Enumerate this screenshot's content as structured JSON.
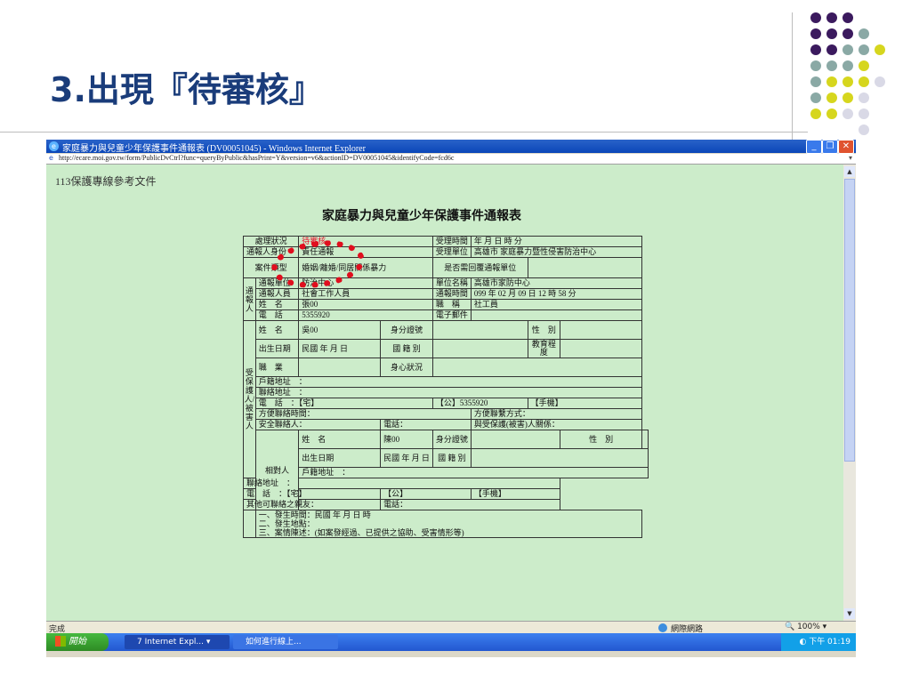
{
  "slide": {
    "title": "3.出現『待審核』",
    "palette": {
      "purple": "#3b1a5e",
      "teal": "#8aa9a5",
      "yellow": "#d6d61e",
      "light": "#d9d9e6"
    }
  },
  "window": {
    "title": "家庭暴力與兒童少年保護事件通報表 (DV00051045) - Windows Internet Explorer",
    "address": "http://ecare.moi.gov.tw/form/PublicDvCtrl?func=queryByPublic&hasPrint=Y&version=v6&actionID=DV00051045&identifyCode=fcd6c",
    "status_text": "完成",
    "zone": "網際網路",
    "zoom": "100%",
    "minimize_icon": "minimize-icon",
    "maximize_icon": "restore-icon",
    "close_icon": "close-icon"
  },
  "taskbar": {
    "start": "開始",
    "items": [
      "7 Internet Expl...",
      "如何進行線上..."
    ],
    "clock": "下午 01:19"
  },
  "document": {
    "ref_text": "113保護專線參考文件",
    "heading": "家庭暴力與兒童少年保護事件通報表"
  },
  "report": {
    "row1": {
      "status_label": "處理狀況",
      "status_value": "待審核",
      "time_label": "受理時間",
      "time_value": "年 月 日 時 分"
    },
    "row2": {
      "identity_label": "通報人身份",
      "identity_value": "責任通報",
      "unit_label": "受理單位",
      "unit_value": "高雄市 家庭暴力暨性侵害防治中心"
    },
    "row3": {
      "type_label": "案件類型",
      "type_value": "婚姻/離婚/同居關係暴力",
      "reply_label": "是否需回覆通報單位"
    },
    "reporter": {
      "group_label": "通報人",
      "unit_label": "通報單位",
      "unit_value": "防治中心",
      "unitname_label": "單位名稱",
      "unitname_value": "高雄市家防中心",
      "person_label": "通報人員",
      "person_value": "社會工作人員",
      "rtime_label": "通報時間",
      "rtime_value": "099 年 02 月 09 日 12 時 58 分",
      "name_label": "姓　名",
      "name_value": "張00",
      "title_label": "職　稱",
      "title_value": "社工員",
      "phone_label": "電　話",
      "phone_value": "5355920",
      "email_label": "電子郵件"
    },
    "victim": {
      "group_label": "受保護人/被害人",
      "name_label": "姓　名",
      "name_value": "吳00",
      "id_label": "身分證號",
      "sex_label": "性　別",
      "birth_label": "出生日期",
      "birth_value": "民國 年 月 日",
      "nationality_label": "國 籍 別",
      "edu_label": "教育程度",
      "job_label": "職　業",
      "health_label": "身心狀況",
      "registered_addr": "戶籍地址　：",
      "contact_addr": "聯絡地址　：",
      "phone_line": [
        "電　話　：【宅】",
        "【公】5355920",
        "【手機】"
      ],
      "contact_time": "方便聯絡時間：",
      "contact_method": "方便聯繫方式：",
      "safe_contact": "安全聯絡人：",
      "safe_phone": "電話：",
      "relation": "與受保護(被害)人關係："
    },
    "offender": {
      "group_label": "相對人",
      "name_label": "姓　名",
      "name_value": "陳00",
      "id_label": "身分證號",
      "sex_label": "性　別",
      "birth_label": "出生日期",
      "birth_value": "民國 年 月 日",
      "nationality_label": "國 籍 別",
      "registered_addr": "戶籍地址　：",
      "contact_addr": "聯絡地址　：",
      "phone_line": [
        "電　話　：【宅】",
        "【公】",
        "【手機】"
      ],
      "other_contact": "其他可聯絡之親友：",
      "other_phone": "電話："
    },
    "incident": [
      "一、發生時間：民國 年 月 日 時",
      "二、發生地點：",
      "三、案情陳述：(如案發經過、已提供之協助、受害情形等)"
    ]
  }
}
